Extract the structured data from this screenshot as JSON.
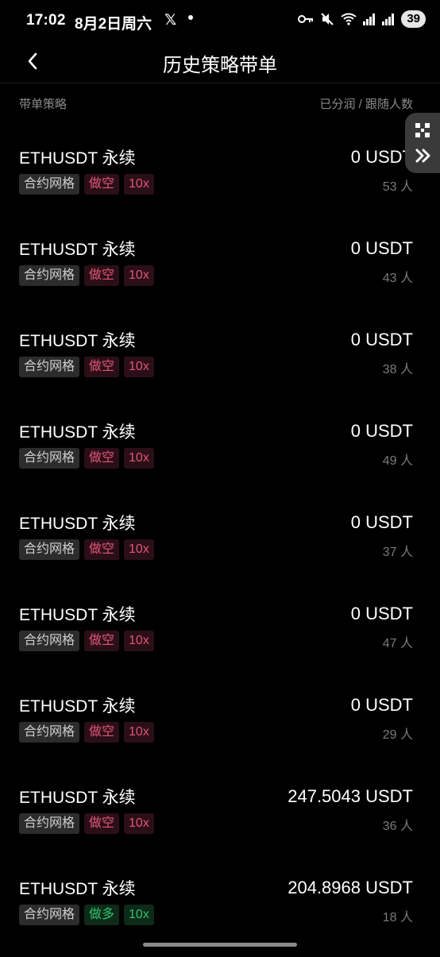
{
  "status_bar": {
    "time": "17:02",
    "date": "8月2日周六",
    "x_glyph": "𝕏",
    "battery": "39"
  },
  "nav": {
    "title": "历史策略带单"
  },
  "header": {
    "left": "带单策略",
    "right": "已分润 / 跟随人数"
  },
  "items": [
    {
      "name": "ETHUSDT 永续",
      "type": "合约网格",
      "direction": "做空",
      "leverage": "10x",
      "profit": "0 USDT",
      "followers": "53 人"
    },
    {
      "name": "ETHUSDT 永续",
      "type": "合约网格",
      "direction": "做空",
      "leverage": "10x",
      "profit": "0 USDT",
      "followers": "43 人"
    },
    {
      "name": "ETHUSDT 永续",
      "type": "合约网格",
      "direction": "做空",
      "leverage": "10x",
      "profit": "0 USDT",
      "followers": "38 人"
    },
    {
      "name": "ETHUSDT 永续",
      "type": "合约网格",
      "direction": "做空",
      "leverage": "10x",
      "profit": "0 USDT",
      "followers": "49 人"
    },
    {
      "name": "ETHUSDT 永续",
      "type": "合约网格",
      "direction": "做空",
      "leverage": "10x",
      "profit": "0 USDT",
      "followers": "37 人"
    },
    {
      "name": "ETHUSDT 永续",
      "type": "合约网格",
      "direction": "做空",
      "leverage": "10x",
      "profit": "0 USDT",
      "followers": "47 人"
    },
    {
      "name": "ETHUSDT 永续",
      "type": "合约网格",
      "direction": "做空",
      "leverage": "10x",
      "profit": "0 USDT",
      "followers": "29 人"
    },
    {
      "name": "ETHUSDT 永续",
      "type": "合约网格",
      "direction": "做空",
      "leverage": "10x",
      "profit": "247.5043 USDT",
      "followers": "36 人"
    },
    {
      "name": "ETHUSDT 永续",
      "type": "合约网格",
      "direction": "做多",
      "leverage": "10x",
      "profit": "204.8968 USDT",
      "followers": "18 人"
    }
  ],
  "colors": {
    "background": "#000000",
    "short": "#e05577",
    "long": "#2fc26d",
    "muted": "#8a8a8a"
  },
  "icons": {
    "back": "chevron-left-icon",
    "qr": "qr-code-icon",
    "forward": "double-chevron-right-icon"
  }
}
